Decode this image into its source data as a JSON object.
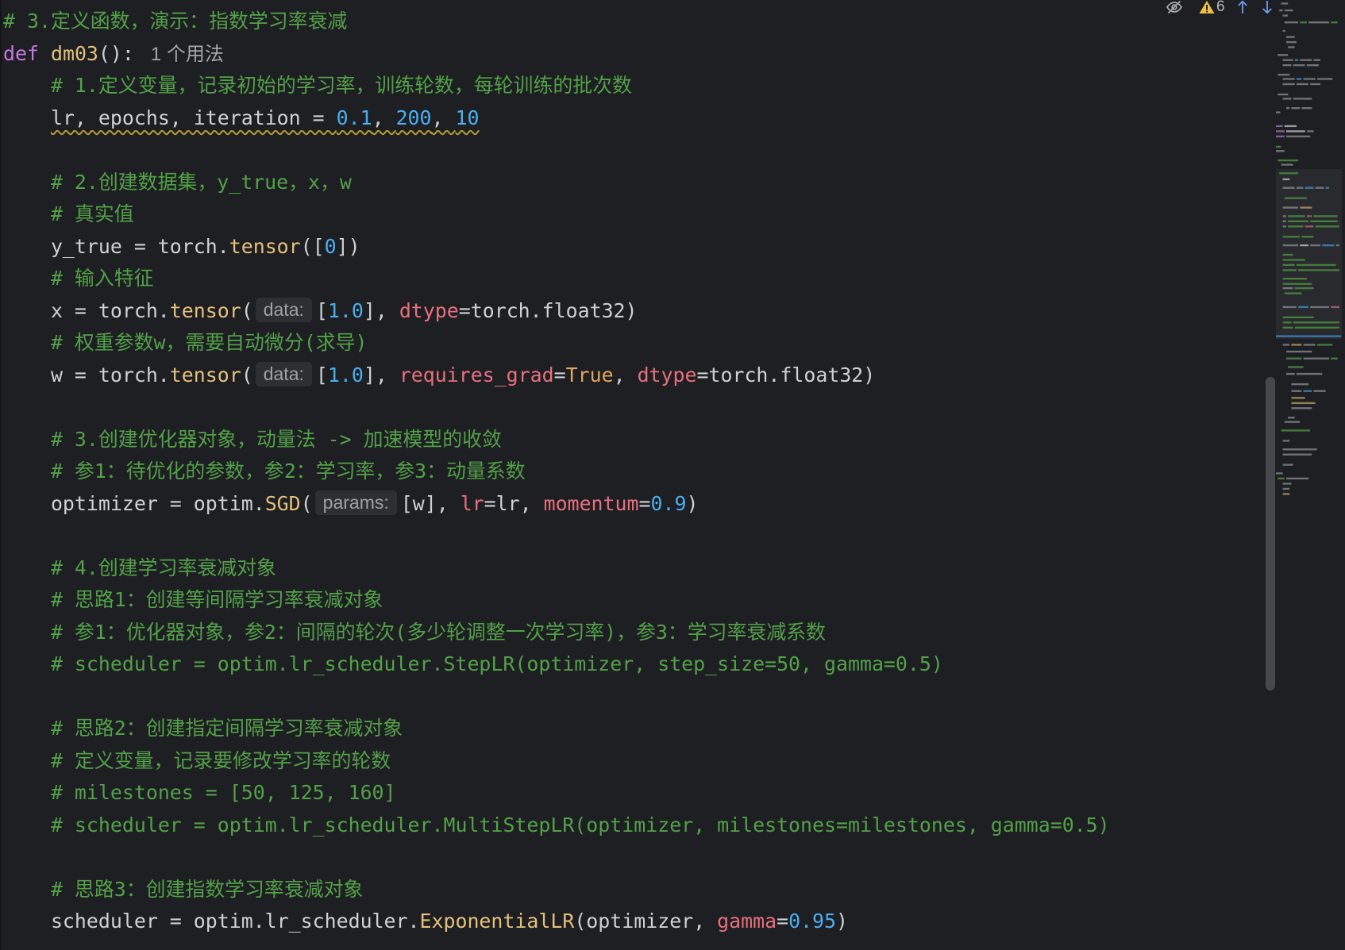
{
  "editor": {
    "lines": [
      [
        {
          "comment": "# 3.定义函数，演示：指数学习率衰减"
        }
      ],
      [
        {
          "keyword": "def"
        },
        {
          "text": " "
        },
        {
          "function": "dm03"
        },
        {
          "text": "():"
        },
        {
          "usage_hint": "1 个用法"
        }
      ],
      [
        {
          "text": "    "
        },
        {
          "comment": "# 1.定义变量，记录初始的学习率，训练轮数，每轮训练的批次数"
        }
      ],
      [
        {
          "text": "    "
        },
        {
          "text": "lr, epochs, iteration = ",
          "warning": true
        },
        {
          "number": "0.1",
          "warning": true
        },
        {
          "text": ", ",
          "warning": true
        },
        {
          "number": "200",
          "warning": true
        },
        {
          "text": ", ",
          "warning": true
        },
        {
          "number": "10",
          "warning": true
        }
      ],
      [],
      [
        {
          "text": "    "
        },
        {
          "comment": "# 2.创建数据集，y_true，x，w"
        }
      ],
      [
        {
          "text": "    "
        },
        {
          "comment": "# 真实值"
        }
      ],
      [
        {
          "text": "    y_true = torch."
        },
        {
          "call": "tensor"
        },
        {
          "text": "(["
        },
        {
          "number": "0"
        },
        {
          "text": "])"
        }
      ],
      [
        {
          "text": "    "
        },
        {
          "comment": "# 输入特征"
        }
      ],
      [
        {
          "text": "    x = torch."
        },
        {
          "call": "tensor"
        },
        {
          "text": "("
        },
        {
          "param_hint": "data:"
        },
        {
          "text": "["
        },
        {
          "number": "1.0"
        },
        {
          "text": "], "
        },
        {
          "kwarg": "dtype"
        },
        {
          "text": "=torch.float32)"
        }
      ],
      [
        {
          "text": "    "
        },
        {
          "comment": "# 权重参数w，需要自动微分(求导)"
        }
      ],
      [
        {
          "text": "    w = torch."
        },
        {
          "call": "tensor"
        },
        {
          "text": "("
        },
        {
          "param_hint": "data:"
        },
        {
          "text": "["
        },
        {
          "number": "1.0"
        },
        {
          "text": "], "
        },
        {
          "kwarg": "requires_grad"
        },
        {
          "text": "="
        },
        {
          "constant": "True"
        },
        {
          "text": ", "
        },
        {
          "kwarg": "dtype"
        },
        {
          "text": "=torch.float32)"
        }
      ],
      [],
      [
        {
          "text": "    "
        },
        {
          "comment": "# 3.创建优化器对象，动量法 -> 加速模型的收敛"
        }
      ],
      [
        {
          "text": "    "
        },
        {
          "comment": "# 参1：待优化的参数，参2：学习率，参3：动量系数"
        }
      ],
      [
        {
          "text": "    optimizer = optim."
        },
        {
          "call": "SGD"
        },
        {
          "text": "("
        },
        {
          "param_hint": "params:"
        },
        {
          "text": "[w], "
        },
        {
          "kwarg": "lr"
        },
        {
          "text": "=lr, "
        },
        {
          "kwarg": "momentum"
        },
        {
          "text": "="
        },
        {
          "number": "0.9"
        },
        {
          "text": ")"
        }
      ],
      [],
      [
        {
          "text": "    "
        },
        {
          "comment": "# 4.创建学习率衰减对象"
        }
      ],
      [
        {
          "text": "    "
        },
        {
          "comment": "# 思路1：创建等间隔学习率衰减对象"
        }
      ],
      [
        {
          "text": "    "
        },
        {
          "comment": "# 参1：优化器对象，参2：间隔的轮次(多少轮调整一次学习率)，参3：学习率衰减系数"
        }
      ],
      [
        {
          "text": "    "
        },
        {
          "comment": "# scheduler = optim.lr_scheduler.StepLR(optimizer, step_size=50, gamma=0.5)"
        }
      ],
      [],
      [
        {
          "text": "    "
        },
        {
          "comment": "# 思路2：创建指定间隔学习率衰减对象"
        }
      ],
      [
        {
          "text": "    "
        },
        {
          "comment": "# 定义变量，记录要修改学习率的轮数"
        }
      ],
      [
        {
          "text": "    "
        },
        {
          "comment": "# milestones = [50, 125, 160]"
        }
      ],
      [
        {
          "text": "    "
        },
        {
          "comment": "# scheduler = optim.lr_scheduler.MultiStepLR(optimizer, milestones=milestones, gamma=0.5)"
        }
      ],
      [],
      [
        {
          "text": "    "
        },
        {
          "comment": "# 思路3：创建指数学习率衰减对象"
        }
      ],
      [
        {
          "text": "    scheduler = optim.lr_scheduler."
        },
        {
          "call": "ExponentialLR"
        },
        {
          "text": "(optimizer, "
        },
        {
          "kwarg": "gamma"
        },
        {
          "text": "="
        },
        {
          "number": "0.95"
        },
        {
          "text": ")"
        }
      ]
    ]
  },
  "inspections": {
    "warning_count": "6"
  },
  "icons": {
    "reader_toggle": "eye-slash-icon",
    "warnings": "warning-icon",
    "previous_highlight": "arrow-up-icon",
    "next_highlight": "arrow-down-icon"
  },
  "theme": {
    "background": "#1e1f22",
    "gutter_border": "#141517",
    "text": "#cdd0d5",
    "comment": "#52a148",
    "keyword": "#c678dd",
    "function": "#e5c07b",
    "call": "#e5c07b",
    "number": "#4aaef0",
    "kwarg": "#e8707d",
    "constant": "#e2a55f",
    "param_hint_text": "#9ea1a6",
    "param_hint_background": "#2d2f33",
    "usage_hint": "#a3a6ab",
    "warning_squiggle": "#b59b34",
    "scrollbar_thumb": "#46484c",
    "minimap_viewport": "#292a2e",
    "warning_icon": "#f0c046",
    "nav_arrows": "#6d9cf2",
    "toolbar_icon": "#a6a9ae"
  }
}
